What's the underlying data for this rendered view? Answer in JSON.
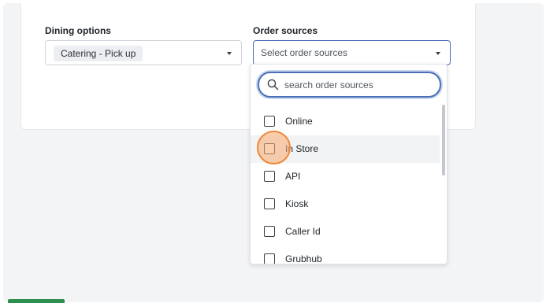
{
  "form": {
    "dining_options": {
      "label": "Dining options",
      "selected_chip": "Catering - Pick up"
    },
    "order_sources": {
      "label": "Order sources",
      "placeholder": "Select order sources"
    }
  },
  "dropdown": {
    "search_placeholder": "search order sources",
    "options": [
      {
        "label": "Online",
        "checked": false
      },
      {
        "label": "In Store",
        "checked": false
      },
      {
        "label": "API",
        "checked": false
      },
      {
        "label": "Kiosk",
        "checked": false
      },
      {
        "label": "Caller Id",
        "checked": false
      },
      {
        "label": "Grubhub",
        "checked": false
      }
    ]
  },
  "colors": {
    "focus_border": "#4a6fb5",
    "cursor_highlight": "#f0883a",
    "footer_accent": "#2f8f4e"
  },
  "icons": {
    "search": "search-icon",
    "dropdown_caret": "chevron-down-icon",
    "checkbox": "checkbox-icon"
  }
}
